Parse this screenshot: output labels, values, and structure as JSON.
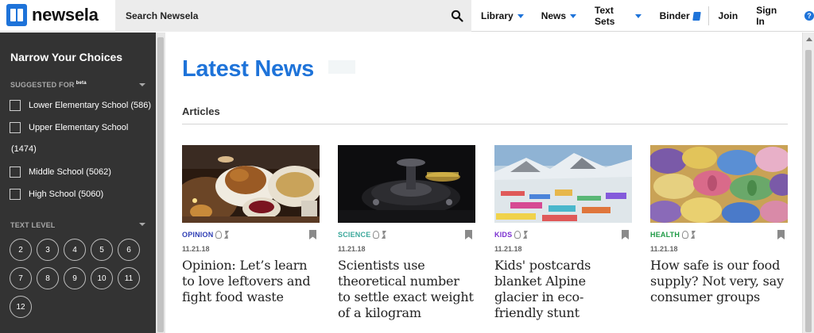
{
  "brand": {
    "name": "newsela"
  },
  "search": {
    "placeholder": "Search Newsela"
  },
  "nav": {
    "library": "Library",
    "news": "News",
    "text_sets": "Text Sets",
    "binder": "Binder",
    "join": "Join",
    "sign_in": "Sign In",
    "help": "?"
  },
  "sidebar": {
    "title": "Narrow Your Choices",
    "suggested_for": "SUGGESTED FOR",
    "suggested_badge": "beta",
    "grade_filters": [
      {
        "label": "Lower Elementary School (586)"
      },
      {
        "label": "Upper Elementary School"
      },
      {
        "label": "Middle School (5062)"
      },
      {
        "label": "High School (5060)"
      }
    ],
    "upper_count": "(1474)",
    "text_level": "TEXT LEVEL",
    "levels": [
      "2",
      "3",
      "4",
      "5",
      "6",
      "7",
      "8",
      "9",
      "10",
      "11",
      "12"
    ]
  },
  "main": {
    "title": "Latest News",
    "articles_label": "Articles",
    "articles": [
      {
        "category": "OPINION",
        "category_color": "#2f3fb5",
        "date": "11.21.18",
        "title": "Opinion: Let’s learn to love leftovers and fight food waste"
      },
      {
        "category": "SCIENCE",
        "category_color": "#3aa89b",
        "date": "11.21.18",
        "title": "Scientists use theoretical number to settle exact weight of a kilogram"
      },
      {
        "category": "KIDS",
        "category_color": "#7a2fd0",
        "date": "11.21.18",
        "title": "Kids' postcards blanket Alpine glacier in eco-friendly stunt"
      },
      {
        "category": "HEALTH",
        "category_color": "#1e9a45",
        "date": "11.21.18",
        "title": "How safe is our food supply? Not very, say consumer groups"
      }
    ]
  },
  "colors": {
    "accent": "#1e73d9",
    "sidebar": "#333333"
  }
}
